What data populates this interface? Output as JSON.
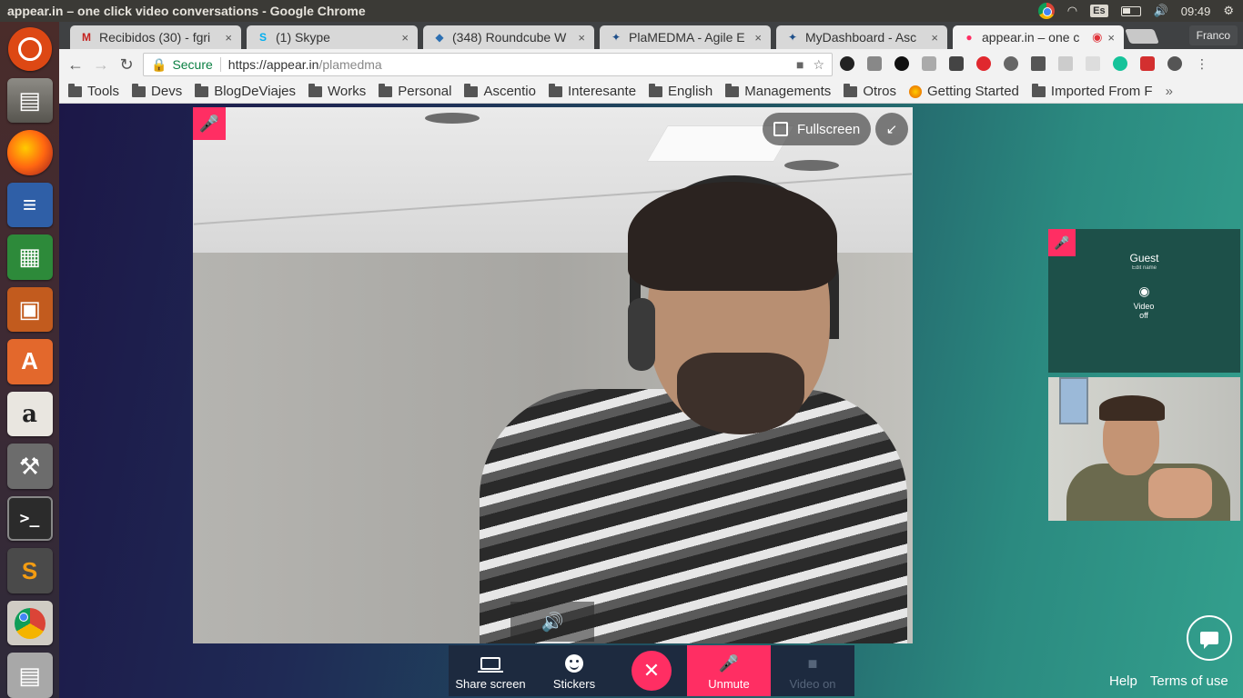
{
  "system": {
    "window_title": "appear.in – one click video conversations - Google Chrome",
    "keyboard_layout": "Es",
    "clock": "09:49"
  },
  "launcher": {
    "items": [
      "ubuntu-icon",
      "files-icon",
      "firefox-icon",
      "writer-icon",
      "calc-icon",
      "impress-icon",
      "software-center-icon",
      "amazon-icon",
      "settings-icon",
      "terminal-icon",
      "sublime-icon",
      "chrome-icon",
      "workspaces-icon"
    ],
    "amazon_glyph": "a",
    "software_glyph": "A",
    "terminal_glyph": ">_",
    "sublime_glyph": "S"
  },
  "tabs": [
    {
      "label": "Recibidos (30) - fgri",
      "favicon": "M",
      "color": "#c5221f"
    },
    {
      "label": "(1) Skype",
      "favicon": "S",
      "color": "#00aff0"
    },
    {
      "label": "(348) Roundcube W",
      "favicon": "◆",
      "color": "#2c6fb2"
    },
    {
      "label": "PlaMEDMA - Agile E",
      "favicon": "✦",
      "color": "#1e4f8a"
    },
    {
      "label": "MyDashboard - Asc",
      "favicon": "✦",
      "color": "#1e4f8a"
    },
    {
      "label": "appear.in – one c",
      "favicon": "●",
      "color": "#ff2e63"
    }
  ],
  "tab_close": "×",
  "profile_name": "Franco",
  "omnibox": {
    "secure_label": "Secure",
    "url_host": "https://appear.in",
    "url_path": "/plamedma"
  },
  "bookmarks": [
    {
      "label": "Tools",
      "type": "folder"
    },
    {
      "label": "Devs",
      "type": "folder"
    },
    {
      "label": "BlogDeViajes",
      "type": "folder"
    },
    {
      "label": "Works",
      "type": "folder"
    },
    {
      "label": "Personal",
      "type": "folder"
    },
    {
      "label": "Ascentio",
      "type": "folder"
    },
    {
      "label": "Interesante",
      "type": "folder"
    },
    {
      "label": "English",
      "type": "folder"
    },
    {
      "label": "Managements",
      "type": "folder"
    },
    {
      "label": "Otros",
      "type": "folder"
    },
    {
      "label": "Getting Started",
      "type": "firefox"
    },
    {
      "label": "Imported From F",
      "type": "folder"
    }
  ],
  "bookmarks_more": "»",
  "call": {
    "fullscreen_label": "Fullscreen",
    "guest_name": "Guest",
    "guest_edit": "Edit name",
    "guest_video_off": "Video off",
    "controls": {
      "share_screen": "Share screen",
      "stickers": "Stickers",
      "unmute": "Unmute",
      "video_on": "Video on"
    },
    "help": "Help",
    "terms": "Terms of use"
  },
  "colors": {
    "accent": "#ff2e63",
    "callbar": "#1d2a3f",
    "guest_tile": "#1d5049"
  }
}
